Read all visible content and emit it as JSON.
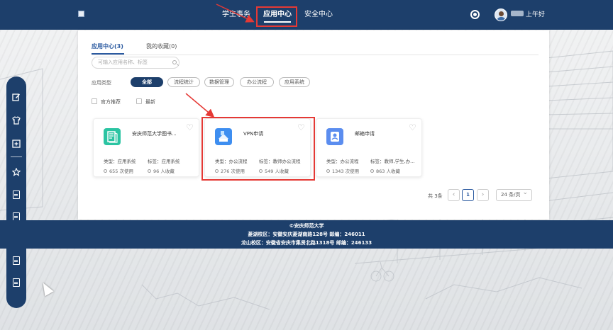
{
  "header": {
    "nav": [
      {
        "label": "学生事务",
        "active": false
      },
      {
        "label": "应用中心",
        "active": true
      },
      {
        "label": "安全中心",
        "active": false
      }
    ],
    "greeting": "上午好"
  },
  "sidebar": {
    "icons": [
      "edit-icon",
      "shirt-icon",
      "add-box-icon",
      "star-icon",
      "document-icon",
      "document-icon",
      "document-icon",
      "document-icon",
      "document-icon"
    ]
  },
  "main": {
    "tabs": [
      {
        "label": "应用中心(3)",
        "active": true
      },
      {
        "label": "我的收藏(0)",
        "active": false
      }
    ],
    "search": {
      "placeholder": "可输入应用名称、标签"
    },
    "type_label": "应用类型",
    "type_chips": [
      {
        "label": "全部",
        "active": true
      },
      {
        "label": "流程统计",
        "active": false
      },
      {
        "label": "数据管理",
        "active": false
      },
      {
        "label": "办公流程",
        "active": false
      },
      {
        "label": "应用系统",
        "active": false
      }
    ],
    "filters": [
      {
        "label": "官方推荐",
        "checked": false
      },
      {
        "label": "最新",
        "checked": false
      }
    ],
    "apps": [
      {
        "title": "安庆师范大学图书...",
        "type": "类型：应用系统",
        "tag": "标签：应用系统",
        "uses": "655 次使用",
        "favorites": "96 人收藏",
        "icon": "library-app-icon",
        "icon_color": "#2bc4a2"
      },
      {
        "title": "VPN申请",
        "type": "类型：办公流程",
        "tag": "标签：教师办公流程",
        "uses": "276 次使用",
        "favorites": "549 人收藏",
        "icon": "vpn-app-icon",
        "icon_color": "#3e8ef0"
      },
      {
        "title": "邮箱申请",
        "type": "类型：办公流程",
        "tag": "标签：教师,学生,办...",
        "uses": "1343 次使用",
        "favorites": "863 人收藏",
        "icon": "mail-app-icon",
        "icon_color": "#5b8def"
      }
    ],
    "pagination": {
      "total": "共 3条",
      "current": "1",
      "page_size": "24 条/页"
    }
  },
  "footer": {
    "line1": "©安庆师范大学",
    "line2": "菱湖校区：安徽安庆菱湖南路128号    邮编：246011",
    "line3": "龙山校区：安徽省安庆市集贤北路1318号 邮编：246133"
  },
  "colors": {
    "brand": "#1d3f6b",
    "accent": "#2b5aa0",
    "annotation": "#e53935"
  }
}
